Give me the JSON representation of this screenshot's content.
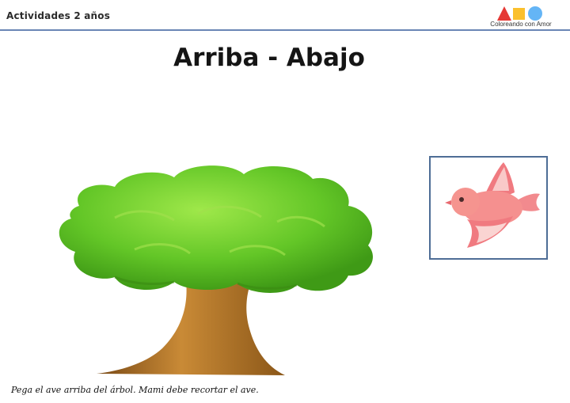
{
  "header": {
    "left_label": "Actividades 2 años",
    "brand": {
      "text": "Coloreando con Amor",
      "shape_colors": [
        "#e53935",
        "#fbc02d",
        "#64b5f6"
      ]
    }
  },
  "title": "Arriba - Abajo",
  "illustrations": {
    "tree": "tree-illustration",
    "bird": "bird-illustration"
  },
  "instruction": "Pega el ave arriba del árbol. Mami debe recortar el ave."
}
